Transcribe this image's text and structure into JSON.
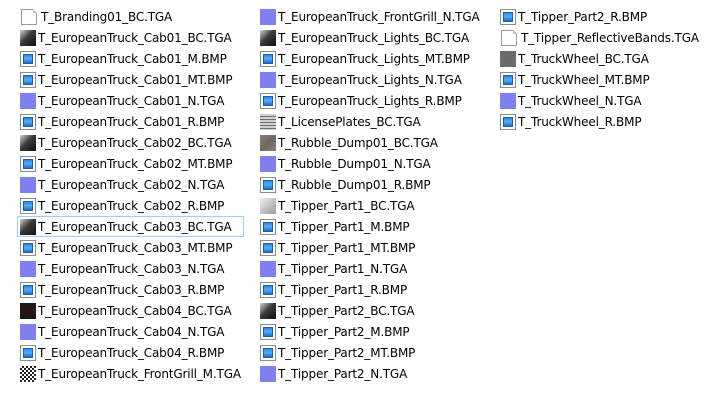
{
  "file_list": {
    "columns": [
      [
        {
          "name": "T_Branding01_BC.TGA",
          "icon": "blank-file-icon"
        },
        {
          "name": "T_EuropeanTruck_Cab01_BC.TGA",
          "icon": "dark-texture-icon"
        },
        {
          "name": "T_EuropeanTruck_Cab01_M.BMP",
          "icon": "bitmap-image-icon"
        },
        {
          "name": "T_EuropeanTruck_Cab01_MT.BMP",
          "icon": "bitmap-image-icon"
        },
        {
          "name": "T_EuropeanTruck_Cab01_N.TGA",
          "icon": "normal-map-icon"
        },
        {
          "name": "T_EuropeanTruck_Cab01_R.BMP",
          "icon": "bitmap-image-icon"
        },
        {
          "name": "T_EuropeanTruck_Cab02_BC.TGA",
          "icon": "dark-texture-icon"
        },
        {
          "name": "T_EuropeanTruck_Cab02_MT.BMP",
          "icon": "bitmap-image-icon"
        },
        {
          "name": "T_EuropeanTruck_Cab02_N.TGA",
          "icon": "normal-map-icon"
        },
        {
          "name": "T_EuropeanTruck_Cab02_R.BMP",
          "icon": "bitmap-image-icon"
        },
        {
          "name": "T_EuropeanTruck_Cab03_BC.TGA",
          "icon": "dark-texture-icon"
        },
        {
          "name": "T_EuropeanTruck_Cab03_MT.BMP",
          "icon": "bitmap-image-icon"
        },
        {
          "name": "T_EuropeanTruck_Cab03_N.TGA",
          "icon": "normal-map-icon"
        },
        {
          "name": "T_EuropeanTruck_Cab03_R.BMP",
          "icon": "bitmap-image-icon"
        },
        {
          "name": "T_EuropeanTruck_Cab04_BC.TGA",
          "icon": "dark-red-texture-icon"
        },
        {
          "name": "T_EuropeanTruck_Cab04_N.TGA",
          "icon": "normal-map-icon"
        },
        {
          "name": "T_EuropeanTruck_Cab04_R.BMP",
          "icon": "bitmap-image-icon"
        },
        {
          "name": "T_EuropeanTruck_FrontGrill_M.TGA",
          "icon": "checker-texture-icon"
        }
      ],
      [
        {
          "name": "T_EuropeanTruck_FrontGrill_N.TGA",
          "icon": "normal-map-icon"
        },
        {
          "name": "T_EuropeanTruck_Lights_BC.TGA",
          "icon": "dark-texture-icon"
        },
        {
          "name": "T_EuropeanTruck_Lights_MT.BMP",
          "icon": "bitmap-image-icon"
        },
        {
          "name": "T_EuropeanTruck_Lights_N.TGA",
          "icon": "normal-map-icon"
        },
        {
          "name": "T_EuropeanTruck_Lights_R.BMP",
          "icon": "bitmap-image-icon"
        },
        {
          "name": "T_LicensePlates_BC.TGA",
          "icon": "plates-texture-icon"
        },
        {
          "name": "T_Rubble_Dump01_BC.TGA",
          "icon": "rubble-texture-icon"
        },
        {
          "name": "T_Rubble_Dump01_N.TGA",
          "icon": "normal-map-icon"
        },
        {
          "name": "T_Rubble_Dump01_R.BMP",
          "icon": "bitmap-image-icon"
        },
        {
          "name": "T_Tipper_Part1_BC.TGA",
          "icon": "light-texture-icon"
        },
        {
          "name": "T_Tipper_Part1_M.BMP",
          "icon": "bitmap-image-icon"
        },
        {
          "name": "T_Tipper_Part1_MT.BMP",
          "icon": "bitmap-image-icon"
        },
        {
          "name": "T_Tipper_Part1_N.TGA",
          "icon": "normal-map-icon"
        },
        {
          "name": "T_Tipper_Part1_R.BMP",
          "icon": "bitmap-image-icon"
        },
        {
          "name": "T_Tipper_Part2_BC.TGA",
          "icon": "dark-texture-icon"
        },
        {
          "name": "T_Tipper_Part2_M.BMP",
          "icon": "bitmap-image-icon"
        },
        {
          "name": "T_Tipper_Part2_MT.BMP",
          "icon": "bitmap-image-icon"
        },
        {
          "name": "T_Tipper_Part2_N.TGA",
          "icon": "normal-map-icon"
        }
      ],
      [
        {
          "name": "T_Tipper_Part2_R.BMP",
          "icon": "bitmap-image-icon"
        },
        {
          "name": "T_Tipper_ReflectiveBands.TGA",
          "icon": "blank-file-icon"
        },
        {
          "name": "T_TruckWheel_BC.TGA",
          "icon": "gray-texture-icon"
        },
        {
          "name": "T_TruckWheel_MT.BMP",
          "icon": "bitmap-image-icon"
        },
        {
          "name": "T_TruckWheel_N.TGA",
          "icon": "normal-map-icon"
        },
        {
          "name": "T_TruckWheel_R.BMP",
          "icon": "bitmap-image-icon"
        }
      ]
    ],
    "focused_item": "T_EuropeanTruck_Cab03_BC.TGA",
    "colors": {
      "background": "#ffffff",
      "focus_border": "#99d1ff",
      "normal_map": "#8080f2",
      "bitmap_blue": "#2f88e6"
    }
  }
}
